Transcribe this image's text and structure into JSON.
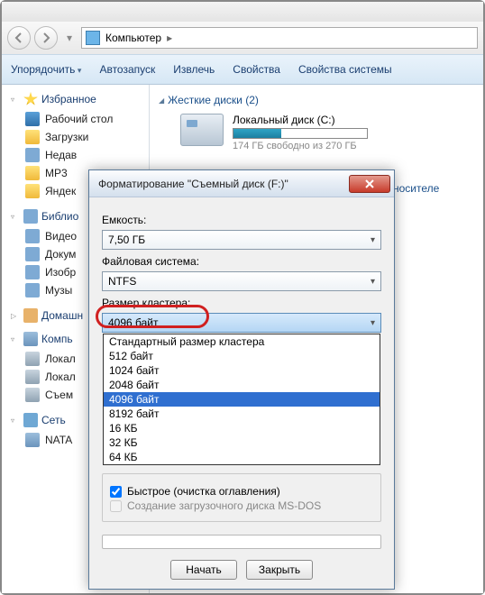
{
  "address": {
    "location": "Компьютер"
  },
  "toolbar": {
    "organize": "Упорядочить",
    "autoplay": "Автозапуск",
    "eject": "Извлечь",
    "properties": "Свойства",
    "system_properties": "Свойства системы"
  },
  "sidebar": {
    "favorites": {
      "title": "Избранное",
      "items": [
        "Рабочий стол",
        "Загрузки",
        "Недав",
        "MP3",
        "Яндек"
      ]
    },
    "libraries": {
      "title": "Библио",
      "items": [
        "Видео",
        "Докум",
        "Изобр",
        "Музы"
      ]
    },
    "homegroup": {
      "title": "Домашн"
    },
    "computer": {
      "title": "Компь",
      "items": [
        "Локал",
        "Локал",
        "Съем"
      ]
    },
    "network": {
      "title": "Сеть",
      "items": [
        "NATA"
      ]
    }
  },
  "content": {
    "hdd_header": "Жесткие диски (2)",
    "drive_name": "Локальный диск (C:)",
    "drive_free": "174 ГБ свободно из 270 ГБ",
    "removable_hint": "носителе"
  },
  "dialog": {
    "title": "Форматирование \"Съемный диск (F:)\"",
    "capacity_label": "Емкость:",
    "capacity_value": "7,50 ГБ",
    "fs_label": "Файловая система:",
    "fs_value": "NTFS",
    "cluster_label": "Размер кластера:",
    "cluster_value": "4096 байт",
    "cluster_options": [
      "Стандартный размер кластера",
      "512 байт",
      "1024 байт",
      "2048 байт",
      "4096 байт",
      "8192 байт",
      "16 КБ",
      "32 КБ",
      "64 КБ"
    ],
    "options_group": "",
    "quick_format": "Быстрое (очистка оглавления)",
    "msdos_boot": "Создание загрузочного диска MS-DOS",
    "start": "Начать",
    "close": "Закрыть"
  }
}
